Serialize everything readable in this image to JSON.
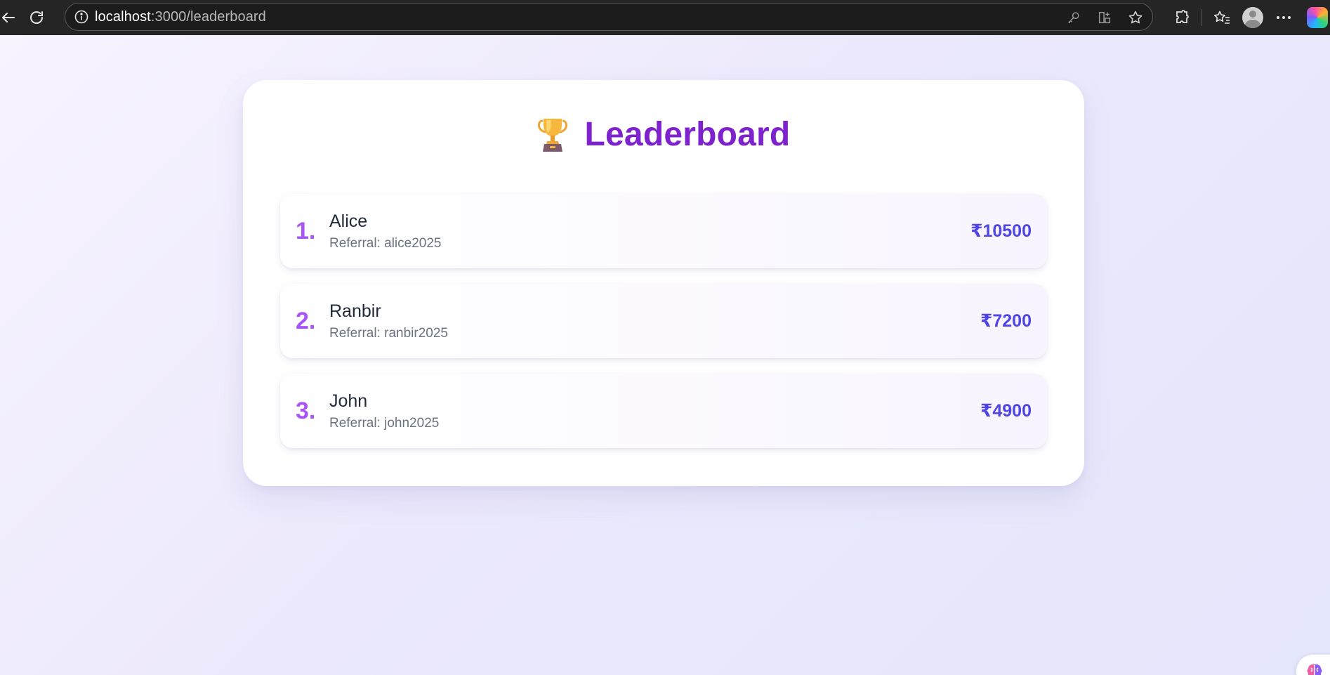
{
  "browser": {
    "url_host": "localhost",
    "url_rest": ":3000/leaderboard"
  },
  "page": {
    "title": "Leaderboard",
    "title_icon": "trophy-icon"
  },
  "entries": [
    {
      "rank": "1.",
      "name": "Alice",
      "referral": "Referral: alice2025",
      "amount": "₹10500"
    },
    {
      "rank": "2.",
      "name": "Ranbir",
      "referral": "Referral: ranbir2025",
      "amount": "₹7200"
    },
    {
      "rank": "3.",
      "name": "John",
      "referral": "Referral: john2025",
      "amount": "₹4900"
    }
  ],
  "colors": {
    "title": "#7e22ce",
    "rank": "#a855f7",
    "amount": "#4f46e5"
  }
}
